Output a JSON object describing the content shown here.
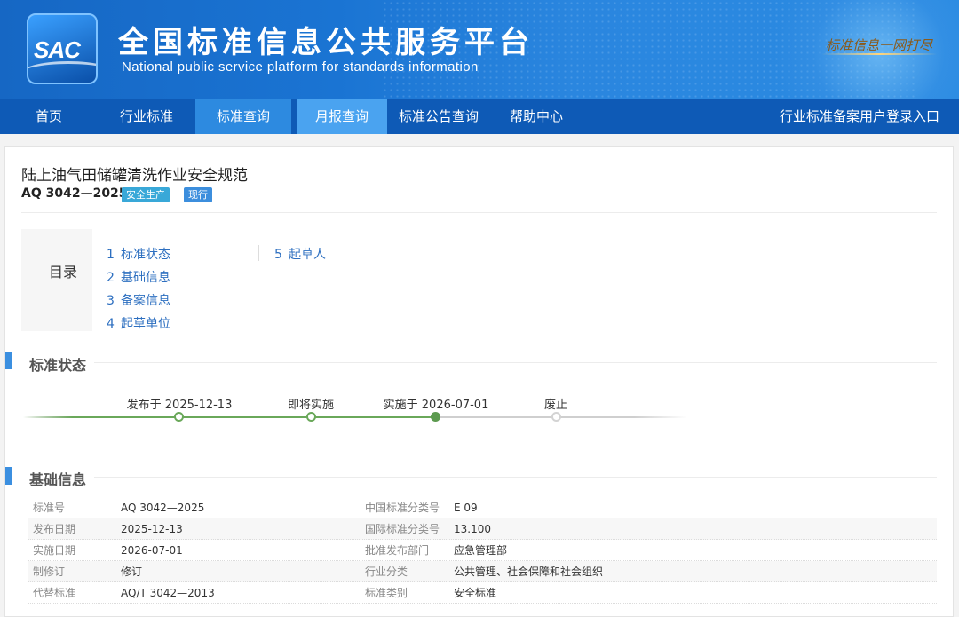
{
  "header": {
    "logo_text": "SAC",
    "title_cn": "全国标准信息公共服务平台",
    "title_en": "National public service platform  for standards information",
    "slogan": "标准信息一网打尽"
  },
  "nav": {
    "items": [
      "首页",
      "行业标准",
      "标准查询",
      "月报查询",
      "标准公告查询",
      "帮助中心"
    ],
    "login": "行业标准备案用户登录入口"
  },
  "standard": {
    "name": "陆上油气田储罐清洗作业安全规范",
    "code": "AQ 3042—2025",
    "category_badge": "安全生产",
    "state_badge": "现行"
  },
  "toc": {
    "label": "目录",
    "items": [
      {
        "num": "1",
        "text": "标准状态"
      },
      {
        "num": "2",
        "text": "基础信息"
      },
      {
        "num": "3",
        "text": "备案信息"
      },
      {
        "num": "4",
        "text": "起草单位"
      },
      {
        "num": "5",
        "text": "起草人"
      }
    ]
  },
  "status_section": {
    "title": "标准状态",
    "steps": [
      {
        "label": "发布于 2025-12-13",
        "state": "done"
      },
      {
        "label": "即将实施",
        "state": "done"
      },
      {
        "label": "实施于 2026-07-01",
        "state": "current"
      },
      {
        "label": "废止",
        "state": "pending"
      }
    ]
  },
  "basic_section": {
    "title": "基础信息",
    "rows": [
      {
        "k1": "标准号",
        "v1": "AQ 3042—2025",
        "k2": "中国标准分类号",
        "v2": "E 09"
      },
      {
        "k1": "发布日期",
        "v1": "2025-12-13",
        "k2": "国际标准分类号",
        "v2": "13.100"
      },
      {
        "k1": "实施日期",
        "v1": "2026-07-01",
        "k2": "批准发布部门",
        "v2": "应急管理部"
      },
      {
        "k1": "制修订",
        "v1": "修订",
        "k2": "行业分类",
        "v2": "公共管理、社会保障和社会组织"
      },
      {
        "k1": "代替标准",
        "v1": "AQ/T 3042—2013",
        "k2": "标准类别",
        "v2": "安全标准"
      }
    ]
  },
  "colors": {
    "nav_bg": "#0e5ab6",
    "nav_active": "#2d8ae0",
    "accent": "#3b8fe0",
    "timeline_green": "#6aa85a"
  }
}
